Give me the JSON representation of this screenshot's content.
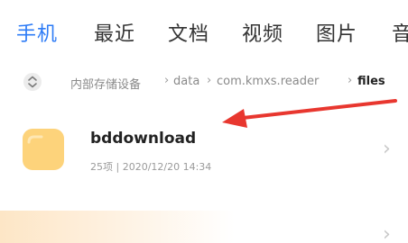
{
  "tabs": [
    {
      "label": "手机",
      "active": true
    },
    {
      "label": "最近",
      "active": false
    },
    {
      "label": "文档",
      "active": false
    },
    {
      "label": "视频",
      "active": false
    },
    {
      "label": "图片",
      "active": false
    },
    {
      "label": "音",
      "active": false
    }
  ],
  "breadcrumb": {
    "items": [
      "内部存储设备",
      "data",
      "com.kmxs.reader",
      "files"
    ],
    "separator": "›"
  },
  "folders": [
    {
      "name": "bddownload",
      "meta": "25项 | 2020/12/20 14:34"
    }
  ],
  "colors": {
    "accent": "#2e7cf6",
    "folder": "#fdd37b",
    "arrow": "#e8372f"
  }
}
